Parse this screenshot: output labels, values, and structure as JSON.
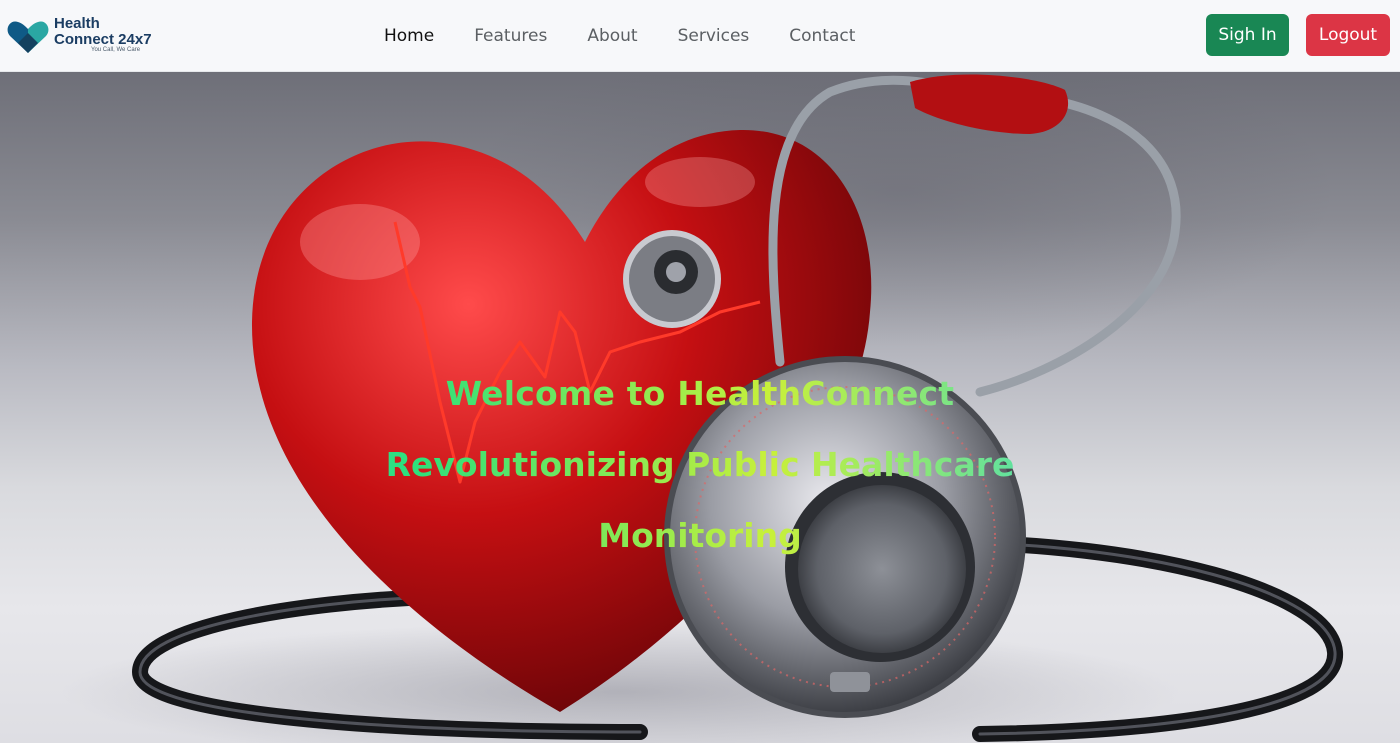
{
  "brand": {
    "name_line1": "Health",
    "name_line2": "Connect 24x7",
    "tagline": "You Call, We Care",
    "colors": {
      "primary": "#1b3d63",
      "accent": "#2aa7a3"
    }
  },
  "nav": {
    "links": [
      {
        "label": "Home",
        "active": true
      },
      {
        "label": "Features",
        "active": false
      },
      {
        "label": "About",
        "active": false
      },
      {
        "label": "Services",
        "active": false
      },
      {
        "label": "Contact",
        "active": false
      }
    ]
  },
  "auth": {
    "signin_label": "Sigh In",
    "logout_label": "Logout",
    "signin_color": "#198754",
    "logout_color": "#dc3545"
  },
  "hero": {
    "line1": "Welcome to HealthConnect",
    "line2": "Revolutionizing Public Healthcare",
    "line3": "Monitoring",
    "image_subject": "heart-stethoscope-illustration"
  }
}
